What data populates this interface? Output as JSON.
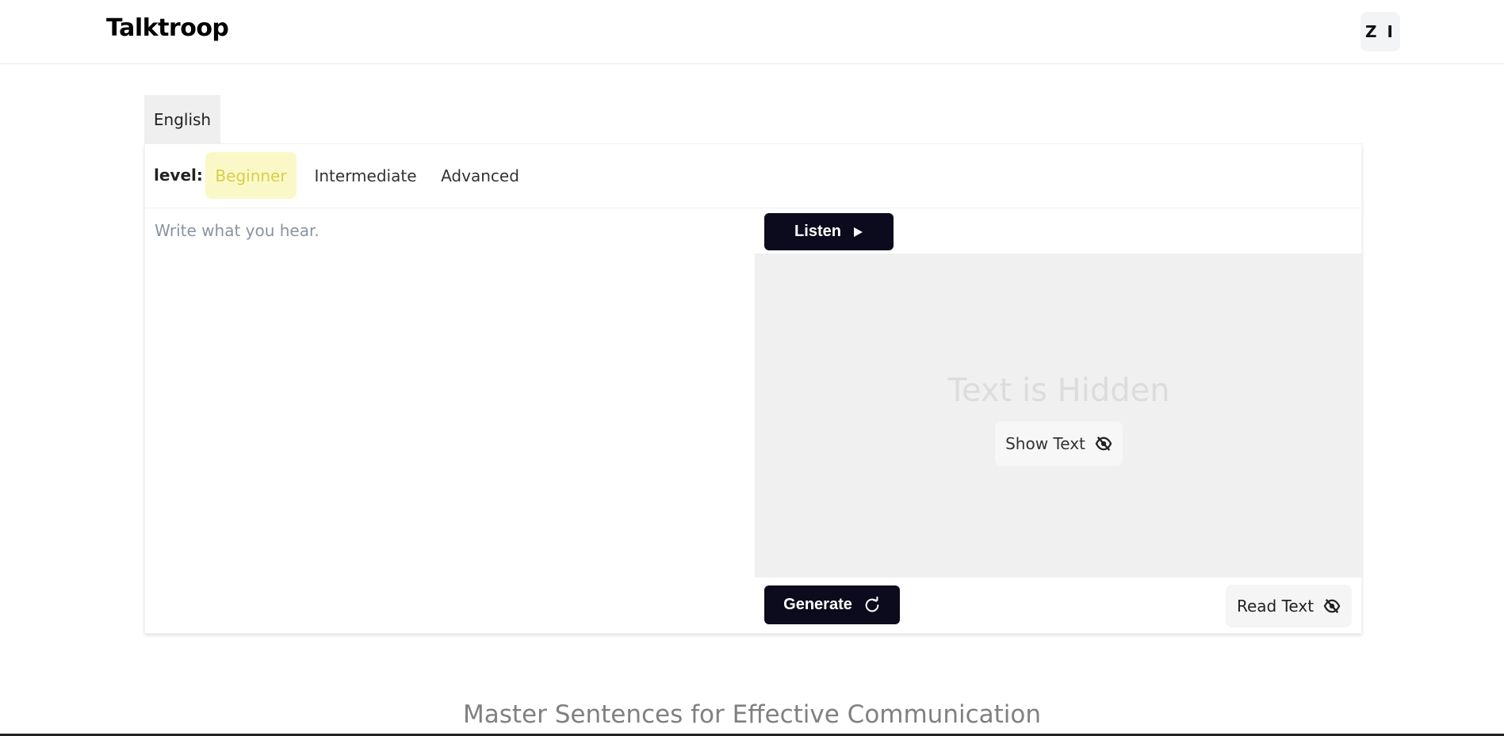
{
  "header": {
    "logo": "Talktroop",
    "avatar_initials": "Z I"
  },
  "language_tab": "English",
  "levels": {
    "label": "level:",
    "options": [
      "Beginner",
      "Intermediate",
      "Advanced"
    ],
    "selected": "Beginner"
  },
  "answer": {
    "placeholder": "Write what you hear.",
    "value": ""
  },
  "player": {
    "listen_label": "Listen",
    "hidden_title": "Text is Hidden",
    "show_text_label": "Show Text",
    "generate_label": "Generate",
    "read_text_label": "Read Text"
  },
  "icons": {
    "listen": "play-icon",
    "show_text": "eye-off-icon",
    "generate": "refresh-icon",
    "read_text": "eye-off-icon"
  },
  "footer": {
    "heading": "Master Sentences for Effective Communication"
  },
  "colors": {
    "primary_button": "#0c0b1d",
    "selected_level_bg": "#fbf8c8",
    "selected_level_text": "#d8cf4a",
    "hidden_panel_bg": "#f0f0f0"
  }
}
